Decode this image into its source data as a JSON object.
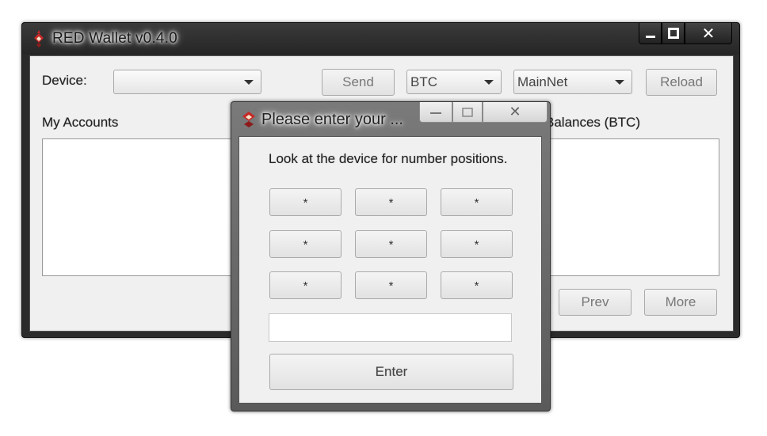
{
  "window": {
    "title": "RED Wallet v0.4.0",
    "close_glyph": "✕"
  },
  "toolbar": {
    "device_label": "Device:",
    "device_value": "",
    "send_label": "Send",
    "currency_value": "BTC",
    "network_value": "MainNet",
    "reload_label": "Reload"
  },
  "accounts": {
    "label": "My Accounts",
    "balances_label": "Balances (BTC)"
  },
  "paging": {
    "prev_label": "Prev",
    "more_label": "More"
  },
  "pin_dialog": {
    "title": "Please enter your ...",
    "close_glyph": "✕",
    "hint": "Look at the device for number positions.",
    "keys": [
      "*",
      "*",
      "*",
      "*",
      "*",
      "*",
      "*",
      "*",
      "*"
    ],
    "input_value": "",
    "enter_label": "Enter"
  },
  "colors": {
    "brand_red": "#c62828",
    "window_frame": "#2b2b2b",
    "client_bg": "#f0f0f0"
  }
}
